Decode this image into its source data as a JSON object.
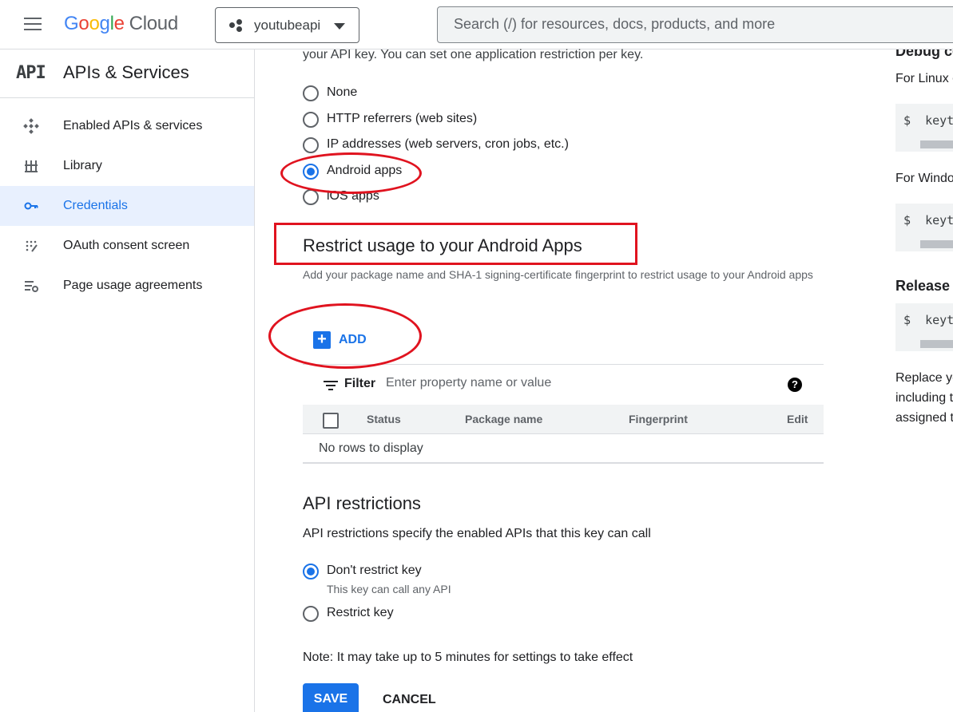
{
  "topbar": {
    "logo_letters": [
      "G",
      "o",
      "o",
      "g",
      "l",
      "e"
    ],
    "logo_suffix": "Cloud",
    "project_name": "youtubeapi",
    "search_placeholder": "Search (/) for resources, docs, products, and more"
  },
  "sidebar": {
    "mark": "API",
    "title": "APIs & Services",
    "items": [
      {
        "label": "Enabled APIs & services",
        "icon": "enabled-apis-icon"
      },
      {
        "label": "Library",
        "icon": "library-icon"
      },
      {
        "label": "Credentials",
        "icon": "key-icon",
        "active": true
      },
      {
        "label": "OAuth consent screen",
        "icon": "oauth-icon"
      },
      {
        "label": "Page usage agreements",
        "icon": "settings-list-icon"
      }
    ]
  },
  "main": {
    "intro": "your API key. You can set one application restriction per key.",
    "app_restrictions": [
      {
        "label": "None",
        "selected": false
      },
      {
        "label": "HTTP referrers (web sites)",
        "selected": false
      },
      {
        "label": "IP addresses (web servers, cron jobs, etc.)",
        "selected": false
      },
      {
        "label": "Android apps",
        "selected": true
      },
      {
        "label": "iOS apps",
        "selected": false
      }
    ],
    "android_title": "Restrict usage to your Android Apps",
    "android_desc": "Add your package name and SHA-1 signing-certificate fingerprint to restrict usage to your Android apps",
    "add_label": "ADD",
    "filter_label": "Filter",
    "filter_placeholder": "Enter property name or value",
    "table_headers": [
      "Status",
      "Package name",
      "Fingerprint",
      "Edit"
    ],
    "empty_text": "No rows to display",
    "api_title": "API restrictions",
    "api_desc": "API restrictions specify the enabled APIs that this key can call",
    "api_options": [
      {
        "label": "Don't restrict key",
        "sub": "This key can call any API",
        "selected": true
      },
      {
        "label": "Restrict key",
        "selected": false
      }
    ],
    "note": "Note: It may take up to 5 minutes for settings to take effect",
    "save_label": "SAVE",
    "cancel_label": "CANCEL"
  },
  "right_panel": {
    "heading1": "Debug ce",
    "linux_text": "For Linux o",
    "code1": "$  keyto",
    "windows_text": "For Windo",
    "code2": "$  keyto",
    "heading2": "Release",
    "code3": "$  keyto",
    "replace_lines": [
      "Replace yo",
      "including t",
      "assigned t"
    ]
  },
  "colors": {
    "accent": "#1a73e8",
    "annotation": "#e0131f",
    "active_bg": "#e8f0fe"
  }
}
